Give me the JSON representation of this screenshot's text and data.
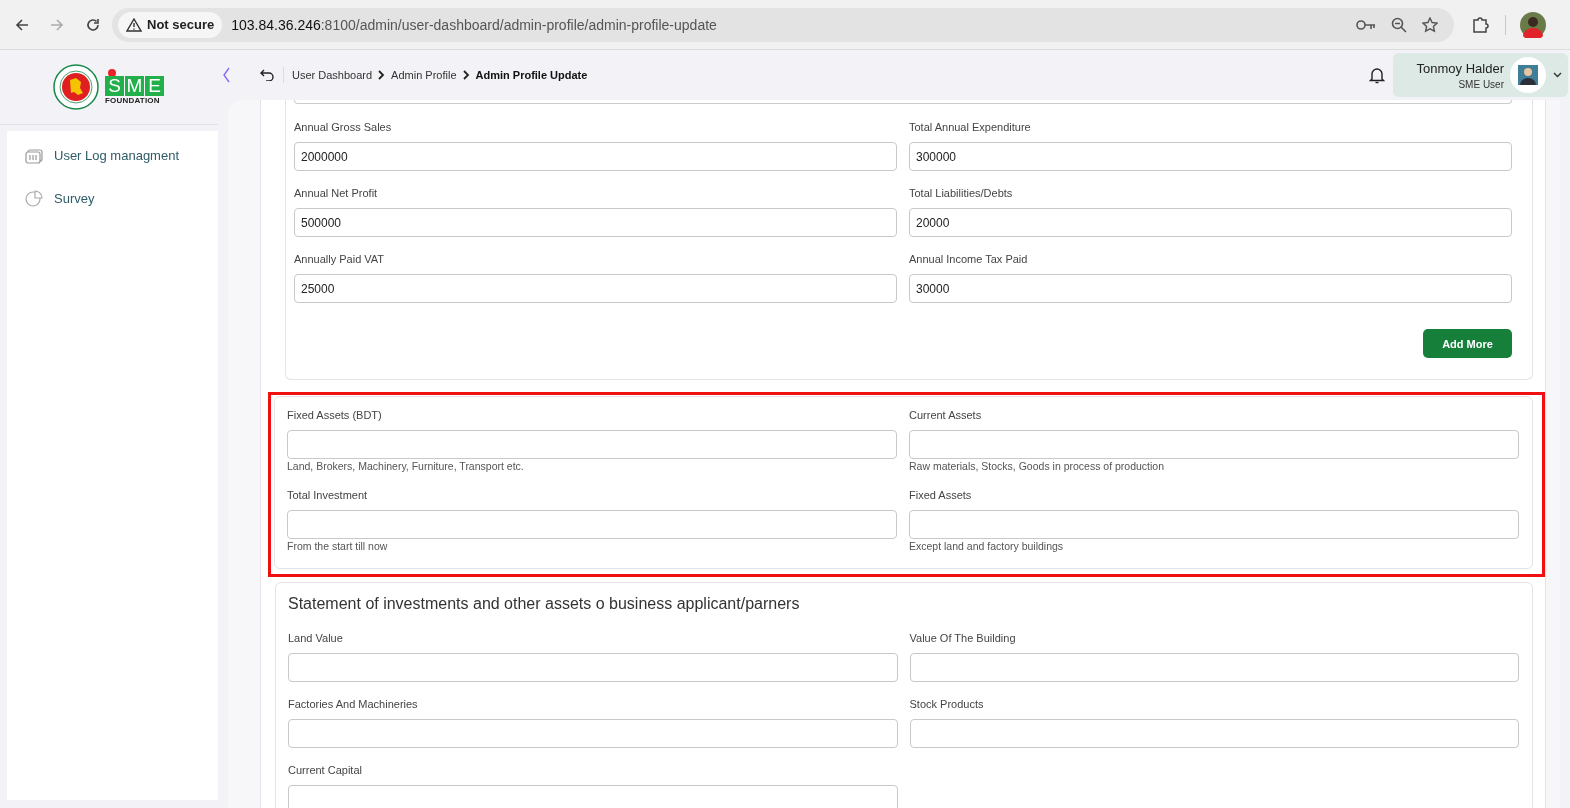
{
  "browser": {
    "security": "Not secure",
    "url_host": "103.84.36.246",
    "url_path": ":8100/admin/user-dashboard/admin-profile/admin-profile-update"
  },
  "logo": {
    "letters": [
      "S",
      "M",
      "E"
    ],
    "caption": "FOUNDATION"
  },
  "sidebar": {
    "items": [
      {
        "label": "User Log managment",
        "selected": false
      },
      {
        "label": "Survey",
        "selected": false
      }
    ]
  },
  "breadcrumb": [
    {
      "label": "User Dashboard",
      "current": false
    },
    {
      "label": "Admin Profile",
      "current": false
    },
    {
      "label": "Admin Profile Update",
      "current": true
    }
  ],
  "user": {
    "name": "Tonmoy Halder",
    "role": "SME User"
  },
  "sections": [
    {
      "cut_top": true,
      "fields": [
        {
          "label": "Annual Gross Sales",
          "value": "2000000"
        },
        {
          "label": "Total Annual Expenditure",
          "value": "300000"
        },
        {
          "label": "Annual Net Profit",
          "value": "500000"
        },
        {
          "label": "Total Liabilities/Debts",
          "value": "20000"
        },
        {
          "label": "Annually Paid VAT",
          "value": "25000"
        },
        {
          "label": "Annual Income Tax Paid",
          "value": "30000"
        }
      ],
      "button": "Add More"
    },
    {
      "highlighted": true,
      "fields": [
        {
          "label": "Fixed Assets (BDT)",
          "hint": "Land, Brokers, Machinery, Furniture, Transport etc."
        },
        {
          "label": "Current Assets",
          "hint": "Raw materials, Stocks, Goods in process of production"
        },
        {
          "label": "Total Investment",
          "hint": "From the start till now"
        },
        {
          "label": "Fixed Assets",
          "hint": "Except land and factory buildings"
        }
      ]
    },
    {
      "title": "Statement of investments and other assets o business applicant/parners",
      "fields": [
        {
          "label": "Land Value"
        },
        {
          "label": "Value Of The Building"
        },
        {
          "label": "Factories And Machineries"
        },
        {
          "label": "Stock Products"
        },
        {
          "label": "Current Capital"
        }
      ]
    }
  ]
}
